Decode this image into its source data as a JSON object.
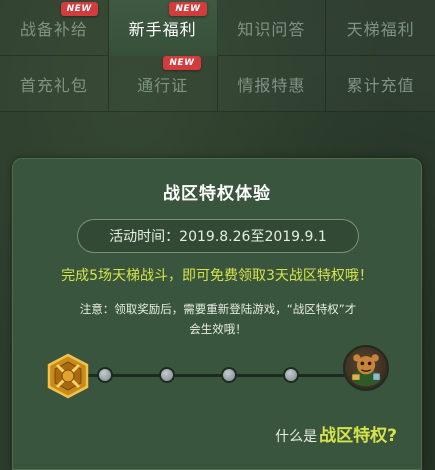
{
  "tabs": [
    {
      "label": "战备补给",
      "badge": "NEW",
      "active": false
    },
    {
      "label": "新手福利",
      "badge": "NEW",
      "active": true
    },
    {
      "label": "知识问答",
      "badge": "",
      "active": false
    },
    {
      "label": "天梯福利",
      "badge": "",
      "active": false
    },
    {
      "label": "首充礼包",
      "badge": "",
      "active": false
    },
    {
      "label": "通行证",
      "badge": "NEW",
      "active": false
    },
    {
      "label": "情报特惠",
      "badge": "",
      "active": false
    },
    {
      "label": "累计充值",
      "badge": "",
      "active": false
    }
  ],
  "panel": {
    "title": "战区特权体验",
    "time_label": "活动时间：2019.8.26至2019.9.1",
    "description": "完成5场天梯战斗，即可免费领取3天战区特权哦！",
    "note_line1": "注意：领取奖励后，需要重新登陆游戏，“战区特权”才",
    "note_line2": "会生效哦！",
    "progress": {
      "completed": 0,
      "total": 5
    },
    "help_prefix": "什么是",
    "help_link": "战区特权?"
  },
  "colors": {
    "background": "#2b3b2c",
    "panel": "#3a553d",
    "accent": "#d6e44a",
    "badge": "#d33c3c",
    "tab_inactive_text": "#7f9384"
  },
  "icons": {
    "medal": "rank-medal-icon",
    "reward": "reward-character-icon"
  }
}
